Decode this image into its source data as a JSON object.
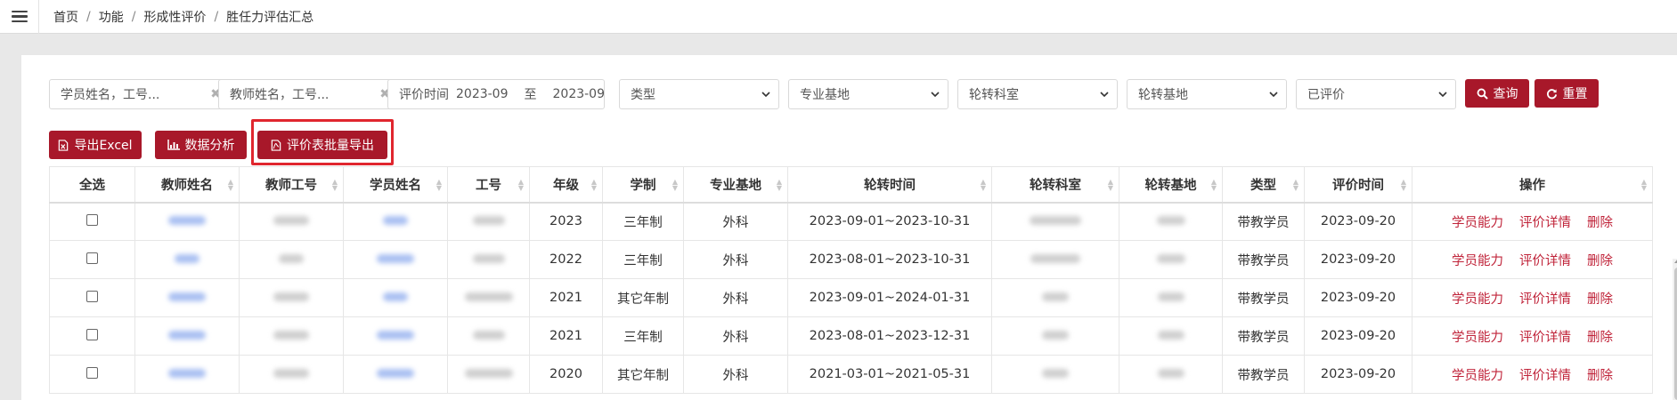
{
  "breadcrumb": {
    "items": [
      "首页",
      "功能",
      "形成性评价",
      "胜任力评估汇总"
    ],
    "separator": "/"
  },
  "filters": {
    "student_placeholder": "学员姓名，工号...",
    "teacher_placeholder": "教师姓名，工号...",
    "clear_glyph": "✖",
    "date_label": "评价时间",
    "date_from": "2023-09",
    "date_to_sep": "至",
    "date_to": "2023-09",
    "type_select": "类型",
    "base_select": "专业基地",
    "dept_select": "轮转科室",
    "rotation_base_select": "轮转基地",
    "status_select": "已评价",
    "search_label": "查询",
    "reset_label": "重置"
  },
  "toolbar": {
    "export_excel_label": "导出Excel",
    "analysis_label": "数据分析",
    "batch_export_label": "评价表批量导出"
  },
  "table": {
    "headers": [
      "全选",
      "教师姓名",
      "教师工号",
      "学员姓名",
      "工号",
      "年级",
      "学制",
      "专业基地",
      "轮转时间",
      "轮转科室",
      "轮转基地",
      "类型",
      "评价时间",
      "操作"
    ],
    "rows": [
      {
        "grade": "2023",
        "system": "三年制",
        "base": "外科",
        "rotation_time": "2023-09-01~2023-10-31",
        "type": "带教学员",
        "eval_time": "2023-09-20"
      },
      {
        "grade": "2022",
        "system": "三年制",
        "base": "外科",
        "rotation_time": "2023-08-01~2023-10-31",
        "type": "带教学员",
        "eval_time": "2023-09-20"
      },
      {
        "grade": "2021",
        "system": "其它年制",
        "base": "外科",
        "rotation_time": "2023-09-01~2024-01-31",
        "type": "带教学员",
        "eval_time": "2023-09-20"
      },
      {
        "grade": "2021",
        "system": "三年制",
        "base": "外科",
        "rotation_time": "2023-08-01~2023-12-31",
        "type": "带教学员",
        "eval_time": "2023-09-20"
      },
      {
        "grade": "2020",
        "system": "其它年制",
        "base": "外科",
        "rotation_time": "2021-03-01~2021-05-31",
        "type": "带教学员",
        "eval_time": "2023-09-20"
      }
    ],
    "actions": [
      "学员能力",
      "评价详情",
      "删除"
    ]
  },
  "colors": {
    "accent": "#a8182a",
    "link": "#c0243a",
    "highlight": "#e0262e"
  }
}
